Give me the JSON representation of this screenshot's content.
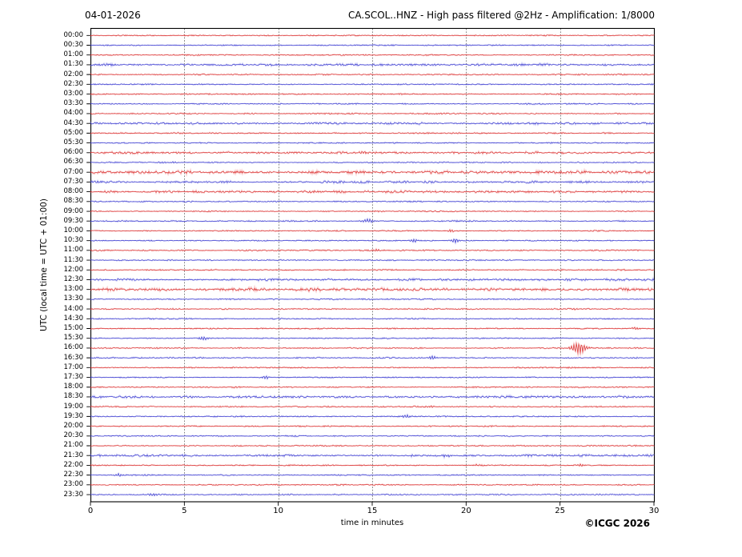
{
  "chart_data": {
    "type": "line",
    "subtype": "seismogram-helicorder",
    "date": "04-01-2026",
    "title": "CA.SCOL..HNZ - High pass filtered @2Hz - Amplification: 1/8000",
    "xlabel": "time in minutes",
    "ylabel": "UTC (local time = UTC + 01:00)",
    "credit": "©ICGC 2026",
    "xlim": [
      0,
      30
    ],
    "x_ticks": [
      0,
      5,
      10,
      15,
      20,
      25,
      30
    ],
    "grid": "vertical dotted lines every 5 minutes",
    "legend_position": "none",
    "colors": {
      "trace_hour": "#d92f2f",
      "trace_half_hour": "#3a3acd",
      "grid": "#666666",
      "frame": "#000000"
    },
    "row_spacing_minutes": 30,
    "rows": [
      {
        "time": "00:00",
        "color": "red",
        "noise": 1,
        "events": []
      },
      {
        "time": "00:30",
        "color": "blue",
        "noise": 1,
        "events": []
      },
      {
        "time": "01:00",
        "color": "red",
        "noise": 1,
        "events": [
          {
            "min": 24.5,
            "amp": 0.8
          }
        ]
      },
      {
        "time": "01:30",
        "color": "blue",
        "noise": 2,
        "events": []
      },
      {
        "time": "02:00",
        "color": "red",
        "noise": 1,
        "events": []
      },
      {
        "time": "02:30",
        "color": "blue",
        "noise": 1,
        "events": []
      },
      {
        "time": "03:00",
        "color": "red",
        "noise": 1,
        "events": []
      },
      {
        "time": "03:30",
        "color": "blue",
        "noise": 1,
        "events": []
      },
      {
        "time": "04:00",
        "color": "red",
        "noise": 1,
        "events": []
      },
      {
        "time": "04:30",
        "color": "blue",
        "noise": 2,
        "events": []
      },
      {
        "time": "05:00",
        "color": "red",
        "noise": 1,
        "events": []
      },
      {
        "time": "05:30",
        "color": "blue",
        "noise": 1,
        "events": []
      },
      {
        "time": "06:00",
        "color": "red",
        "noise": 2,
        "events": [
          {
            "min": 14.5,
            "amp": 1.5
          }
        ]
      },
      {
        "time": "06:30",
        "color": "blue",
        "noise": 1,
        "events": [
          {
            "min": 4.4,
            "amp": 1.0
          }
        ]
      },
      {
        "time": "07:00",
        "color": "red",
        "noise": 3,
        "events": []
      },
      {
        "time": "07:30",
        "color": "blue",
        "noise": 2,
        "events": [
          {
            "min": 0.5,
            "amp": 1.0
          },
          {
            "min": 5.7,
            "amp": 0.8
          }
        ]
      },
      {
        "time": "08:00",
        "color": "red",
        "noise": 2,
        "events": [
          {
            "min": 11.8,
            "amp": 1.2
          }
        ]
      },
      {
        "time": "08:30",
        "color": "blue",
        "noise": 1,
        "events": []
      },
      {
        "time": "09:00",
        "color": "red",
        "noise": 1,
        "events": []
      },
      {
        "time": "09:30",
        "color": "blue",
        "noise": 1,
        "events": [
          {
            "min": 14.8,
            "amp": 2.5
          }
        ]
      },
      {
        "time": "10:00",
        "color": "red",
        "noise": 1,
        "events": [
          {
            "min": 19.2,
            "amp": 1.5
          }
        ]
      },
      {
        "time": "10:30",
        "color": "blue",
        "noise": 1,
        "events": [
          {
            "min": 17.2,
            "amp": 2.0
          },
          {
            "min": 19.4,
            "amp": 2.5
          }
        ]
      },
      {
        "time": "11:00",
        "color": "red",
        "noise": 1,
        "events": [
          {
            "min": 15.3,
            "amp": 1.5
          }
        ]
      },
      {
        "time": "11:30",
        "color": "blue",
        "noise": 1,
        "events": []
      },
      {
        "time": "12:00",
        "color": "red",
        "noise": 1,
        "events": []
      },
      {
        "time": "12:30",
        "color": "blue",
        "noise": 2,
        "events": []
      },
      {
        "time": "13:00",
        "color": "red",
        "noise": 3,
        "events": [
          {
            "min": 11.7,
            "amp": 1.2
          }
        ]
      },
      {
        "time": "13:30",
        "color": "blue",
        "noise": 1,
        "events": []
      },
      {
        "time": "14:00",
        "color": "red",
        "noise": 1,
        "events": [
          {
            "min": 25.8,
            "amp": 1.0
          }
        ]
      },
      {
        "time": "14:30",
        "color": "blue",
        "noise": 1,
        "events": []
      },
      {
        "time": "15:00",
        "color": "red",
        "noise": 1,
        "events": [
          {
            "min": 29.0,
            "amp": 1.5
          }
        ]
      },
      {
        "time": "15:30",
        "color": "blue",
        "noise": 1,
        "events": [
          {
            "min": 6.0,
            "amp": 2.2
          }
        ]
      },
      {
        "time": "16:00",
        "color": "red",
        "noise": 1,
        "events": [
          {
            "min": 26.0,
            "amp": 7.0
          }
        ]
      },
      {
        "time": "16:30",
        "color": "blue",
        "noise": 1,
        "events": [
          {
            "min": 18.2,
            "amp": 2.2
          }
        ]
      },
      {
        "time": "17:00",
        "color": "red",
        "noise": 1,
        "events": []
      },
      {
        "time": "17:30",
        "color": "blue",
        "noise": 1,
        "events": [
          {
            "min": 9.3,
            "amp": 1.8
          }
        ]
      },
      {
        "time": "18:00",
        "color": "red",
        "noise": 1,
        "events": []
      },
      {
        "time": "18:30",
        "color": "blue",
        "noise": 2,
        "events": []
      },
      {
        "time": "19:00",
        "color": "red",
        "noise": 1,
        "events": [
          {
            "min": 18.1,
            "amp": 1.5
          }
        ]
      },
      {
        "time": "19:30",
        "color": "blue",
        "noise": 1,
        "events": [
          {
            "min": 16.8,
            "amp": 2.2
          }
        ]
      },
      {
        "time": "20:00",
        "color": "red",
        "noise": 1,
        "events": []
      },
      {
        "time": "20:30",
        "color": "blue",
        "noise": 1,
        "events": []
      },
      {
        "time": "21:00",
        "color": "red",
        "noise": 1,
        "events": []
      },
      {
        "time": "21:30",
        "color": "blue",
        "noise": 2,
        "events": [
          {
            "min": 5.0,
            "amp": 1.0
          },
          {
            "min": 19.0,
            "amp": 1.8
          }
        ]
      },
      {
        "time": "22:00",
        "color": "red",
        "noise": 1,
        "events": [
          {
            "min": 20.5,
            "amp": 1.0
          },
          {
            "min": 26.1,
            "amp": 1.5
          }
        ]
      },
      {
        "time": "22:30",
        "color": "blue",
        "noise": 1,
        "events": [
          {
            "min": 1.5,
            "amp": 2.2
          }
        ]
      },
      {
        "time": "23:00",
        "color": "red",
        "noise": 1,
        "events": []
      },
      {
        "time": "23:30",
        "color": "blue",
        "noise": 1,
        "events": [
          {
            "min": 3.3,
            "amp": 1.8
          }
        ]
      }
    ]
  }
}
